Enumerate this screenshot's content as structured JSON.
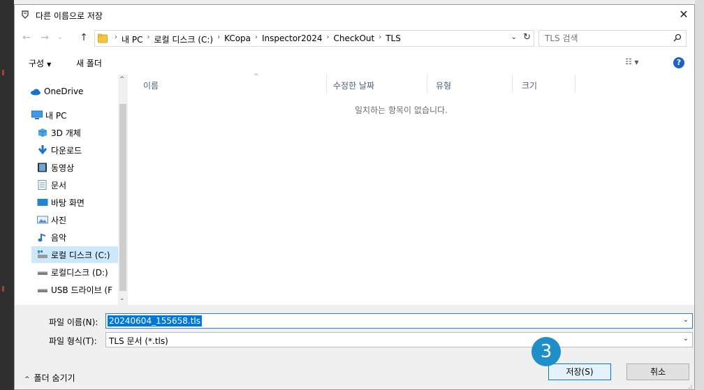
{
  "dialog": {
    "title": "다른 이름으로 저장",
    "close_glyph": "✕"
  },
  "nav": {
    "back_glyph": "←",
    "forward_glyph": "→",
    "recent_glyph": "⌄",
    "up_glyph": "↑",
    "breadcrumbs": [
      "내 PC",
      "로컬 디스크 (C:)",
      "KCopa",
      "Inspector2024",
      "CheckOut",
      "TLS"
    ],
    "breadcrumb_separator": "›",
    "search_placeholder": "TLS 검색"
  },
  "toolbar": {
    "organize_label": "구성",
    "new_folder_label": "새 폴더",
    "help_glyph": "?"
  },
  "sidebar": {
    "items": [
      {
        "label": "OneDrive",
        "icon": "onedrive-icon"
      },
      {
        "label": "내 PC",
        "icon": "pc-icon"
      },
      {
        "label": "3D 개체",
        "icon": "3d-objects-icon"
      },
      {
        "label": "다운로드",
        "icon": "download-icon"
      },
      {
        "label": "동영상",
        "icon": "video-icon"
      },
      {
        "label": "문서",
        "icon": "document-icon"
      },
      {
        "label": "바탕 화면",
        "icon": "desktop-icon"
      },
      {
        "label": "사진",
        "icon": "pictures-icon"
      },
      {
        "label": "음악",
        "icon": "music-icon"
      },
      {
        "label": "로컬 디스크 (C:)",
        "icon": "local-disk-icon",
        "selected": true
      },
      {
        "label": "로컬디스크 (D:)",
        "icon": "drive-icon"
      },
      {
        "label": "USB 드라이브 (F",
        "icon": "usb-drive-icon"
      }
    ]
  },
  "filelist": {
    "columns": [
      "이름",
      "수정한 날짜",
      "유형",
      "크기"
    ],
    "empty_message": "일치하는 항목이 없습니다."
  },
  "form": {
    "filename_label": "파일 이름(N):",
    "filename_value": "20240604_155658.tls",
    "filetype_label": "파일 형식(T):",
    "filetype_value": "TLS 문서 (*.tls)",
    "hide_folders_label": "폴더 숨기기",
    "save_label": "저장(S)",
    "cancel_label": "취소"
  },
  "annotation": {
    "step_number": "3",
    "color": "#1f8fc9"
  }
}
